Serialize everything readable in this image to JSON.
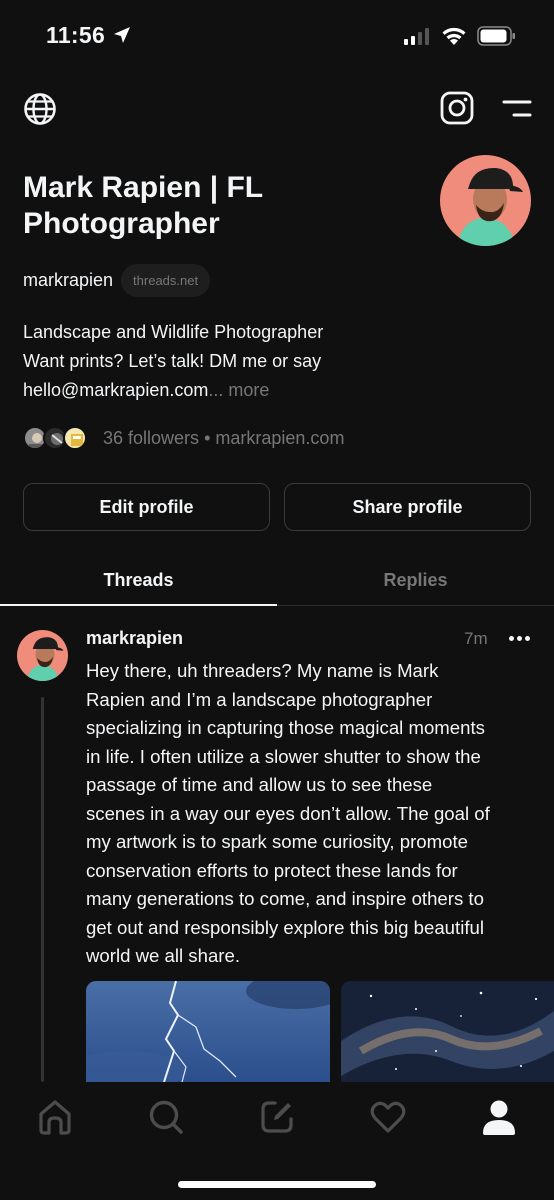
{
  "status_bar": {
    "time": "11:56"
  },
  "profile": {
    "display_name": "Mark Rapien | FL Photographer",
    "handle": "markrapien",
    "domain_badge": "threads.net",
    "bio_lines": [
      "Landscape and Wildlife Photographer",
      "Want prints? Let’s talk! DM me or say",
      "hello@markrapien.com"
    ],
    "bio_ellipsis": "...",
    "bio_more": "more",
    "followers_text": "36 followers",
    "separator": "•",
    "website": "markrapien.com"
  },
  "buttons": {
    "edit": "Edit profile",
    "share": "Share profile"
  },
  "tabs": [
    {
      "label": "Threads",
      "active": true
    },
    {
      "label": "Replies",
      "active": false
    }
  ],
  "post": {
    "author": "markrapien",
    "time": "7m",
    "lines": [
      "Hey there, uh threaders? My name is Mark",
      "Rapien and I’m a landscape photographer",
      "specializing in capturing those magical moments",
      "in life. I often utilize a slower shutter to show the",
      "passage of time and allow us to see these",
      "scenes in a way our eyes don’t allow. The goal of",
      "my artwork is to spark some curiosity, promote",
      "conservation efforts to protect these lands for",
      "many generations to come, and inspire others to",
      "get out and responsibly explore this big beautiful",
      "world we all share."
    ]
  },
  "icons": {
    "top_left": "globe-icon",
    "top_right": [
      "instagram-icon",
      "menu-icon"
    ],
    "bottom_nav": [
      "home-icon",
      "search-icon",
      "compose-icon",
      "heart-icon",
      "profile-icon"
    ]
  },
  "colors": {
    "background": "#101010",
    "text": "#f3f5f7",
    "muted": "#777777",
    "border": "#3a3a3a",
    "avatar_bg": "#f08c7c"
  }
}
